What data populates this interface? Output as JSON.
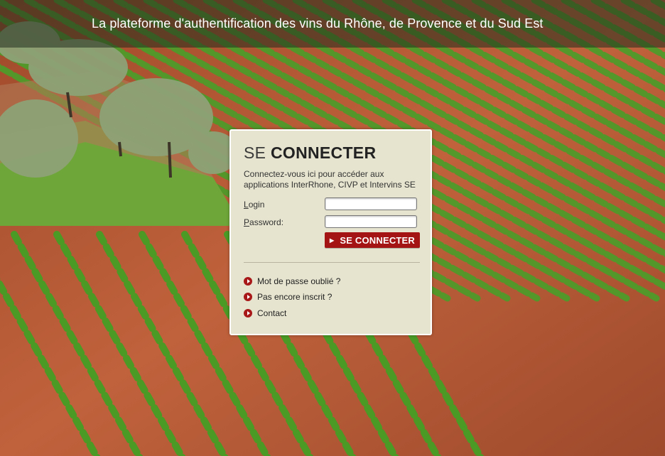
{
  "header": {
    "tagline": "La plateforme d'authentification des vins du Rhône, de Provence et du Sud Est"
  },
  "login": {
    "title_light": "SE ",
    "title_bold": "CONNECTER",
    "intro": "Connectez-vous ici pour accéder aux applications InterRhone, CIVP et Intervins SE",
    "login_label_first": "L",
    "login_label_rest": "ogin",
    "login_value": "",
    "password_label_first": "P",
    "password_label_rest": "assword:",
    "password_value": "",
    "submit_label": "SE CONNECTER"
  },
  "links": [
    {
      "label": "Mot de passe oublié ?"
    },
    {
      "label": "Pas encore inscrit ?"
    },
    {
      "label": "Contact"
    }
  ],
  "colors": {
    "accent": "#a41414",
    "panel": "#e6e4cf",
    "soil": "#b85a36",
    "vine": "#4f9a2a"
  },
  "icons": {
    "bullet": "arrow-right-circle-icon",
    "submit": "arrow-right-icon"
  }
}
